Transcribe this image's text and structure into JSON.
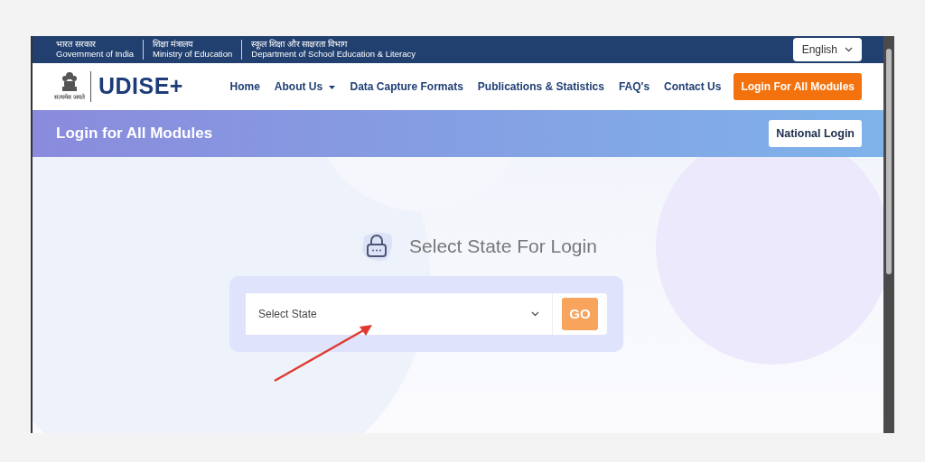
{
  "gov_bar": {
    "items": [
      {
        "hindi": "भारत सरकार",
        "english": "Government of India"
      },
      {
        "hindi": "शिक्षा मंत्रालय",
        "english": "Ministry of Education"
      },
      {
        "hindi": "स्कूल शिक्षा और साक्षरता विभाग",
        "english": "Department of School Education & Literacy"
      }
    ],
    "language": "English"
  },
  "header": {
    "emblem_motto": "सत्यमेव जयते",
    "logo": "UDISE+",
    "nav": [
      {
        "label": "Home",
        "kind": "link"
      },
      {
        "label": "About Us",
        "kind": "dropdown"
      },
      {
        "label": "Data Capture Formats",
        "kind": "link"
      },
      {
        "label": "Publications & Statistics",
        "kind": "link"
      },
      {
        "label": "FAQ's",
        "kind": "link"
      },
      {
        "label": "Contact Us",
        "kind": "link"
      },
      {
        "label": "Login For All Modules",
        "kind": "cta"
      }
    ]
  },
  "banner": {
    "title": "Login for All Modules",
    "button": "National Login"
  },
  "login": {
    "heading": "Select State For Login",
    "select": {
      "placeholder": "Select State"
    },
    "go_button": "GO"
  }
}
